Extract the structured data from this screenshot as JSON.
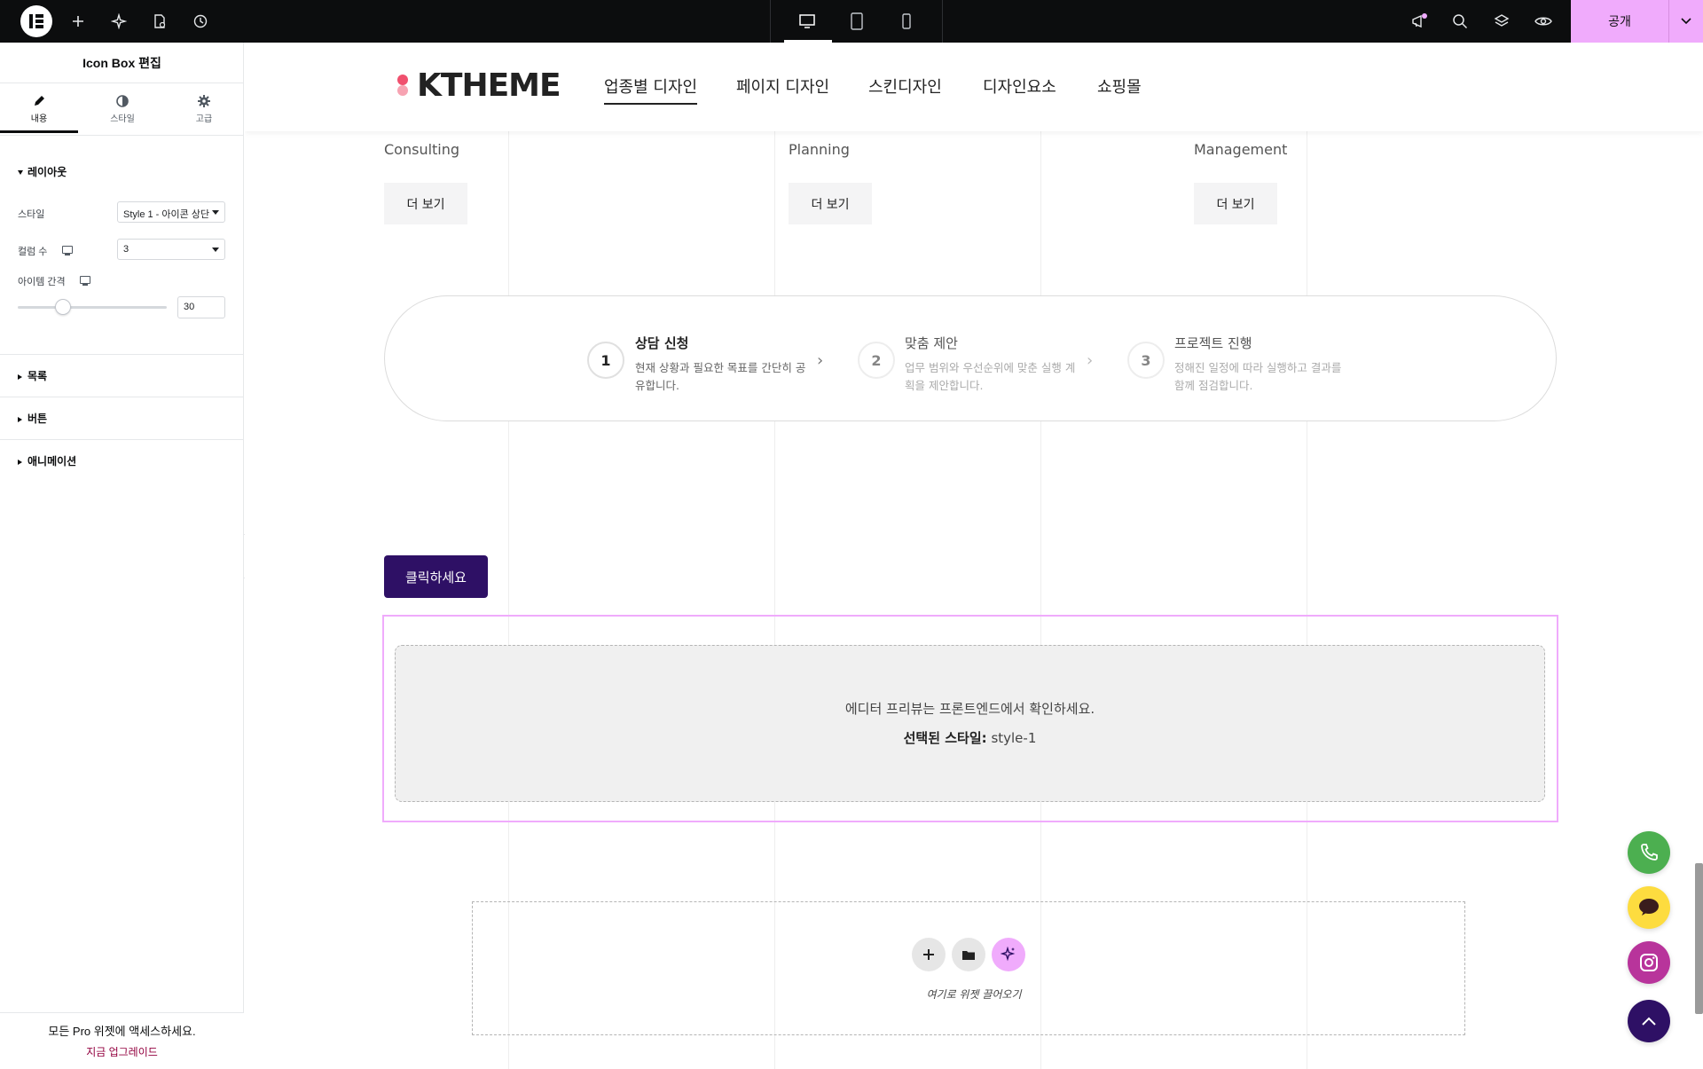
{
  "editor": {
    "publish_label": "공개",
    "panel_title": "Icon Box 편집",
    "tabs": [
      {
        "label": "내용",
        "icon": "pencil-icon"
      },
      {
        "label": "스타일",
        "icon": "contrast-icon"
      },
      {
        "label": "고급",
        "icon": "gear-icon"
      }
    ],
    "sections": {
      "layout": "레이아웃",
      "list": "목록",
      "button": "버튼",
      "animation": "애니메이션"
    },
    "controls": {
      "style_label": "스타일",
      "style_value": "Style 1 - 아이콘 상단",
      "columns_label": "컬럼 수",
      "columns_value": "3",
      "gap_label": "아이템 간격",
      "gap_value": "30",
      "gap_slider_fraction": 0.25
    },
    "pro": {
      "text": "모든 Pro 위젯에 액세스하세요.",
      "link": "지금 업그레이드"
    }
  },
  "site": {
    "logo": "KTHEME",
    "nav": [
      "업종별 디자인",
      "페이지 디자인",
      "스킨디자인",
      "디자인요소",
      "쇼핑몰"
    ],
    "columns": [
      {
        "label": "Consulting",
        "button": "더 보기"
      },
      {
        "label": "Planning",
        "button": "더 보기"
      },
      {
        "label": "Management",
        "button": "더 보기"
      }
    ],
    "steps": [
      {
        "num": "1",
        "title": "상담 신청",
        "desc": "현재 상황과 필요한 목표를 간단히 공유합니다."
      },
      {
        "num": "2",
        "title": "맞춤 제안",
        "desc": "업무 범위와 우선순위에 맞춘 실행 계획을 제안합니다."
      },
      {
        "num": "3",
        "title": "프로젝트 진행",
        "desc": "정해진 일정에 따라 실행하고 결과를 함께 점검합니다."
      }
    ],
    "cta": "클릭하세요",
    "widget_notice": "에디터 프리뷰는 프론트엔드에서 확인하세요.",
    "selected_style_label": "선택된 스타일:",
    "selected_style_value": "style-1",
    "drop_label": "여기로 위젯 끌어오기"
  },
  "colors": {
    "publish": "#f0abfc",
    "cta": "#2e1065",
    "phone": "#4caf50",
    "chat": "#fddc3f",
    "top": "#2e1065"
  }
}
